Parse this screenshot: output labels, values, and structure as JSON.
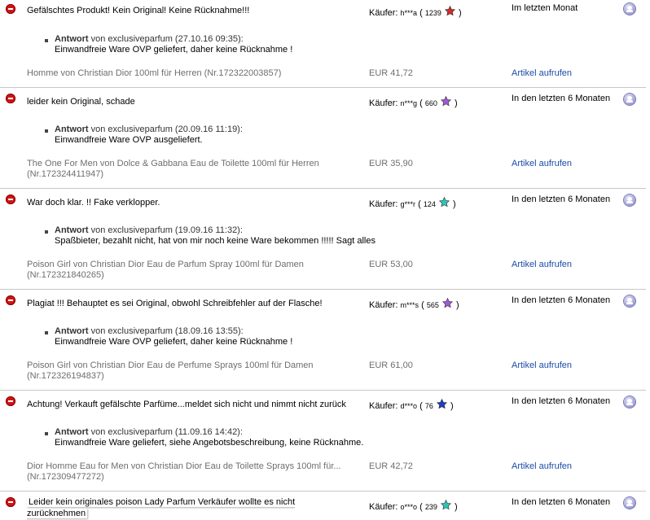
{
  "entries": [
    {
      "comment": "Gefälschtes Produkt! Kein Original! Keine Rücknahme!!!",
      "buyer_prefix": "Käufer:",
      "buyer_name": "h***a",
      "buyer_score": "1239",
      "star_color": "#d22b2b",
      "period": "Im letzten Monat",
      "reply_label": "Antwort",
      "reply_by": "von exclusiveparfum (27.10.16 09:35):",
      "reply_text": "Einwandfreie Ware OVP geliefert, daher keine Rücknahme !",
      "item_title": "Homme von Christian Dior 100ml für Herren (Nr.172322003857)",
      "price": "EUR 41,72",
      "link_label": "Artikel aufrufen"
    },
    {
      "comment": "leider kein Original, schade",
      "buyer_prefix": "Käufer:",
      "buyer_name": "n***g",
      "buyer_score": "660",
      "star_color": "#a05ad2",
      "period": "In den letzten 6 Monaten",
      "reply_label": "Antwort",
      "reply_by": "von exclusiveparfum (20.09.16 11:19):",
      "reply_text": "Einwandfreie Ware OVP ausgeliefert.",
      "item_title": "The One For Men von Dolce & Gabbana Eau de Toilette 100ml für Herren (Nr.172324411947)",
      "price": "EUR 35,90",
      "link_label": "Artikel aufrufen"
    },
    {
      "comment": "War doch klar. !! Fake verklopper.",
      "buyer_prefix": "Käufer:",
      "buyer_name": "g***r",
      "buyer_score": "124",
      "star_color": "#2ec4b6",
      "period": "In den letzten 6 Monaten",
      "reply_label": "Antwort",
      "reply_by": "von exclusiveparfum (19.09.16 11:32):",
      "reply_text": "Spaßbieter, bezahlt nicht, hat von mir noch keine Ware bekommen !!!!! Sagt alles",
      "item_title": "Poison Girl von Christian Dior Eau de Parfum Spray 100ml für Damen (Nr.172321840265)",
      "price": "EUR 53,00",
      "link_label": "Artikel aufrufen"
    },
    {
      "comment": "Plagiat !!! Behauptet es sei Original, obwohl Schreibfehler auf der Flasche!",
      "buyer_prefix": "Käufer:",
      "buyer_name": "m***s",
      "buyer_score": "565",
      "star_color": "#a05ad2",
      "period": "In den letzten 6 Monaten",
      "reply_label": "Antwort",
      "reply_by": "von exclusiveparfum (18.09.16 13:55):",
      "reply_text": "Einwandfreie Ware OVP geliefert, daher keine Rücknahme !",
      "item_title": "Poison Girl von Christian Dior Eau de Perfume Sprays 100ml für Damen (Nr.172326194837)",
      "price": "EUR 61,00",
      "link_label": "Artikel aufrufen"
    },
    {
      "comment": "Achtung! Verkauft gefälschte Parfüme...meldet sich nicht und nimmt nicht zurück",
      "buyer_prefix": "Käufer:",
      "buyer_name": "d***o",
      "buyer_score": "76",
      "star_color": "#1d3fc8",
      "period": "In den letzten 6 Monaten",
      "reply_label": "Antwort",
      "reply_by": "von exclusiveparfum (11.09.16 14:42):",
      "reply_text": "Einwandfreie Ware geliefert, siehe Angebotsbeschreibung, keine Rücknahme.",
      "item_title": "Dior Homme Eau for Men von Christian Dior Eau de Toilette Sprays 100ml für... (Nr.172309477272)",
      "price": "EUR 42,72",
      "link_label": "Artikel aufrufen"
    },
    {
      "comment": "Leider kein originales poison Lady Parfum Verkäufer wollte es nicht zurücknehmen",
      "buyer_prefix": "Käufer:",
      "buyer_name": "o***o",
      "buyer_score": "239",
      "star_color": "#2ec4b6",
      "period": "In den letzten 6 Monaten"
    }
  ]
}
